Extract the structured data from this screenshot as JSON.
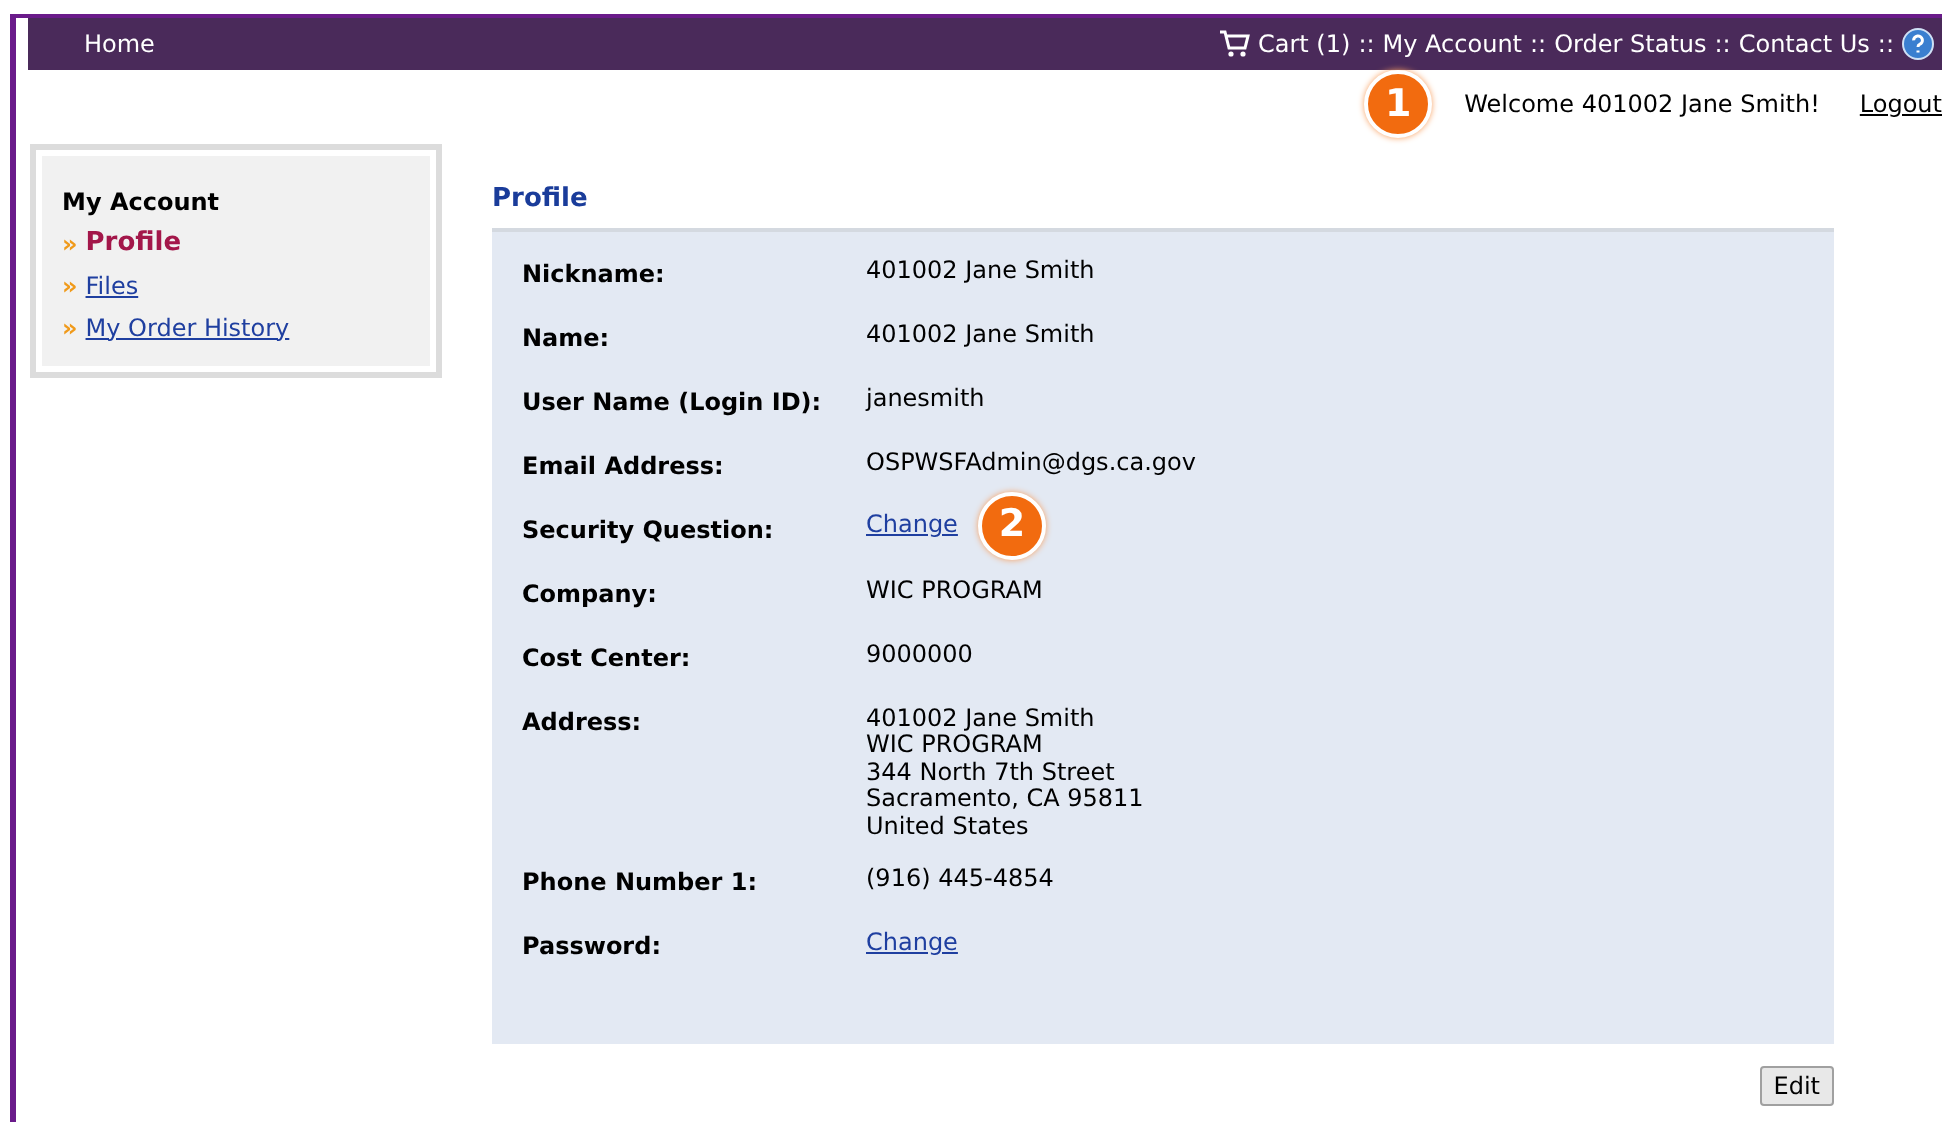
{
  "nav": {
    "home": "Home",
    "links": [
      {
        "label": "Cart (1)",
        "kind": "cart"
      },
      {
        "label": "My Account",
        "kind": "link"
      },
      {
        "label": "Order Status",
        "kind": "link"
      },
      {
        "label": "Contact Us",
        "kind": "link"
      }
    ],
    "separator": "::"
  },
  "welcome": {
    "callout": "1",
    "text": "Welcome 401002 Jane Smith!",
    "logout": "Logout"
  },
  "sidebar": {
    "title": "My Account",
    "bullet": "»",
    "items": [
      {
        "label": "Profile",
        "selected": true
      },
      {
        "label": "Files",
        "selected": false
      },
      {
        "label": "My Order History",
        "selected": false
      }
    ]
  },
  "profile": {
    "title": "Profile",
    "fields": [
      {
        "label": "Nickname:",
        "kind": "text",
        "value": [
          "401002 Jane Smith"
        ]
      },
      {
        "label": "Name:",
        "kind": "text",
        "value": [
          "401002 Jane Smith"
        ]
      },
      {
        "label": "User Name (Login ID):",
        "kind": "text",
        "value": [
          "janesmith"
        ]
      },
      {
        "label": "Email Address:",
        "kind": "text",
        "value": [
          "OSPWSFAdmin@dgs.ca.gov"
        ]
      },
      {
        "label": "Security Question:",
        "kind": "link",
        "value": [
          "Change"
        ],
        "callout": "2"
      },
      {
        "label": "Company:",
        "kind": "text",
        "value": [
          "WIC PROGRAM"
        ]
      },
      {
        "label": "Cost Center:",
        "kind": "text",
        "value": [
          "9000000"
        ]
      },
      {
        "label": "Address:",
        "kind": "text",
        "value": [
          "401002 Jane Smith",
          "WIC PROGRAM",
          "344 North 7th Street",
          "Sacramento, CA 95811",
          "United States"
        ]
      },
      {
        "label": "Phone Number 1:",
        "kind": "text",
        "value": [
          "(916) 445-4854"
        ]
      },
      {
        "label": "Password:",
        "kind": "link",
        "value": [
          "Change"
        ]
      }
    ]
  },
  "edit_button": "Edit"
}
